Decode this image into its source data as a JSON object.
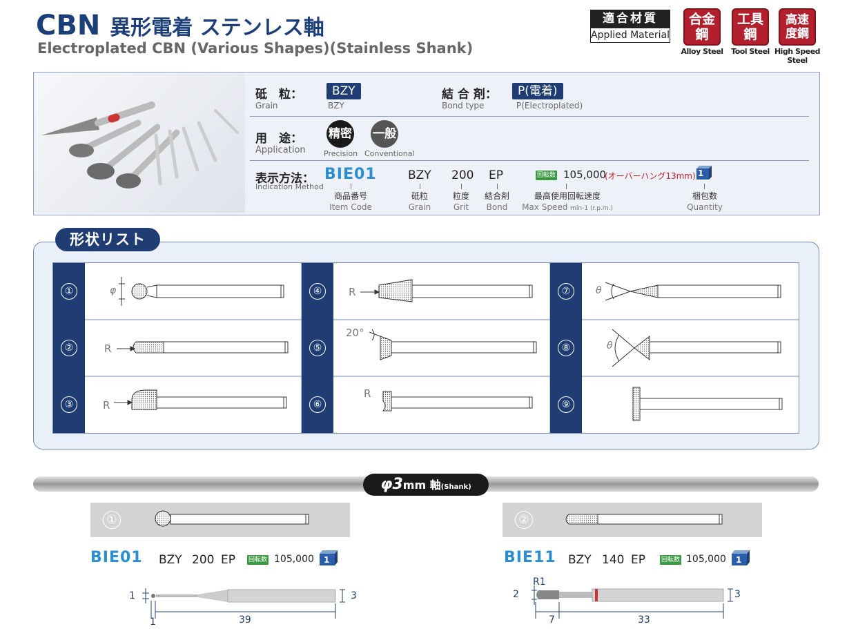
{
  "header": {
    "title_jp_main": "CBN",
    "title_jp_rest": "異形電着 ステンレス軸",
    "title_en": "Electroplated CBN (Various Shapes)(Stainless Shank)",
    "applied_material_jp": "適合材質",
    "applied_material_en": "Applied Material",
    "materials": [
      {
        "jp": "合金鋼",
        "en": "Alloy Steel"
      },
      {
        "jp": "工具鋼",
        "en": "Tool Steel"
      },
      {
        "jp": "高速度鋼",
        "en": "High Speed Steel"
      }
    ]
  },
  "spec": {
    "grain_label": "砥　粒：",
    "grain_sub": "Grain",
    "grain_value": "BZY",
    "grain_value_sub": "BZY",
    "bond_label": "結 合 剤：",
    "bond_sub": "Bond type",
    "bond_value": "P(電着)",
    "bond_value_sub": "P(Electroplated)",
    "application_label": "用　途：",
    "application_sub": "Application",
    "precision_jp": "精密",
    "precision_en": "Precision",
    "conventional_jp": "一般",
    "conventional_en": "Conventional",
    "indication_label": "表示方法：",
    "indication_sub": "Indication Method",
    "ind_code": "BIE01",
    "ind_grain": "BZY",
    "ind_grit": "200",
    "ind_bond": "EP",
    "ind_rot_badge": "回転数",
    "ind_speed": "105,000",
    "ind_overhang": "(オーバーハング13mm)",
    "ind_qty": "1",
    "cap_item_jp": "商品番号",
    "cap_item_en": "Item Code",
    "cap_grain_jp": "砥粒",
    "cap_grain_en": "Grain",
    "cap_grit_jp": "粒度",
    "cap_grit_en": "Grit",
    "cap_bond_jp": "結合剤",
    "cap_bond_en": "Bond",
    "cap_speed_jp": "最高使用回転速度",
    "cap_speed_en": "Max Speed",
    "cap_speed_unit": "min-1 (r.p.m.)",
    "cap_qty_jp": "梱包数",
    "cap_qty_en": "Quantity"
  },
  "shape_list": {
    "title": "形状リスト",
    "cells": [
      {
        "num": "①",
        "label_a": "φ"
      },
      {
        "num": "④",
        "label_a": "R"
      },
      {
        "num": "⑦",
        "label_a": "θ"
      },
      {
        "num": "②",
        "label_a": "R"
      },
      {
        "num": "⑤",
        "label_a": "20°"
      },
      {
        "num": "⑧",
        "label_a": "θ"
      },
      {
        "num": "③",
        "label_a": "R"
      },
      {
        "num": "⑥",
        "label_a": "R"
      },
      {
        "num": "⑨",
        "label_a": ""
      }
    ]
  },
  "shank": {
    "phi": "φ3",
    "mm": "mm",
    "jiku": "軸",
    "en": "(Shank)"
  },
  "products": [
    {
      "num": "①",
      "code": "BIE01",
      "grain": "BZY",
      "grit": "200",
      "bond": "EP",
      "rot": "回転数",
      "speed": "105,000",
      "qty": "1",
      "dim_head": "1",
      "dim_shank": "3",
      "dim_len_a": "1",
      "dim_len_b": "39"
    },
    {
      "num": "②",
      "code": "BIE11",
      "grain": "BZY",
      "grit": "140",
      "bond": "EP",
      "rot": "回転数",
      "speed": "105,000",
      "qty": "1",
      "dim_r": "R1",
      "dim_head": "2",
      "dim_shank": "3",
      "dim_len_a": "7",
      "dim_len_b": "33"
    }
  ],
  "colors": {
    "navy": "#1f3d73",
    "red": "#b21f2d",
    "blue": "#2a8ed0",
    "green": "#3c9a43"
  }
}
